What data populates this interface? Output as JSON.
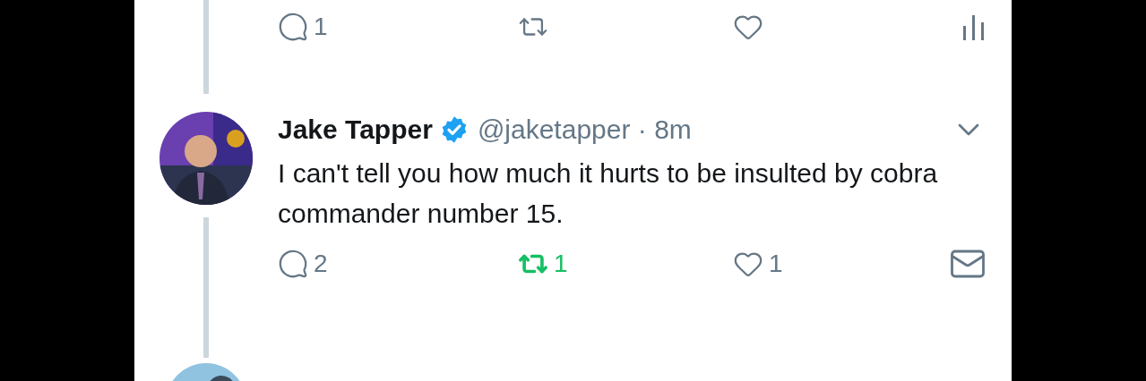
{
  "previous_tweet_actions": {
    "replies": "1"
  },
  "tweet": {
    "name": "Jake Tapper",
    "verified": true,
    "handle": "@jaketapper",
    "separator": "·",
    "time": "8m",
    "text": "I can't tell you how much it hurts to be insulted by cobra commander number 15.",
    "replies": "2",
    "retweets": "1",
    "retweeted": true,
    "likes": "1",
    "liked": false
  }
}
